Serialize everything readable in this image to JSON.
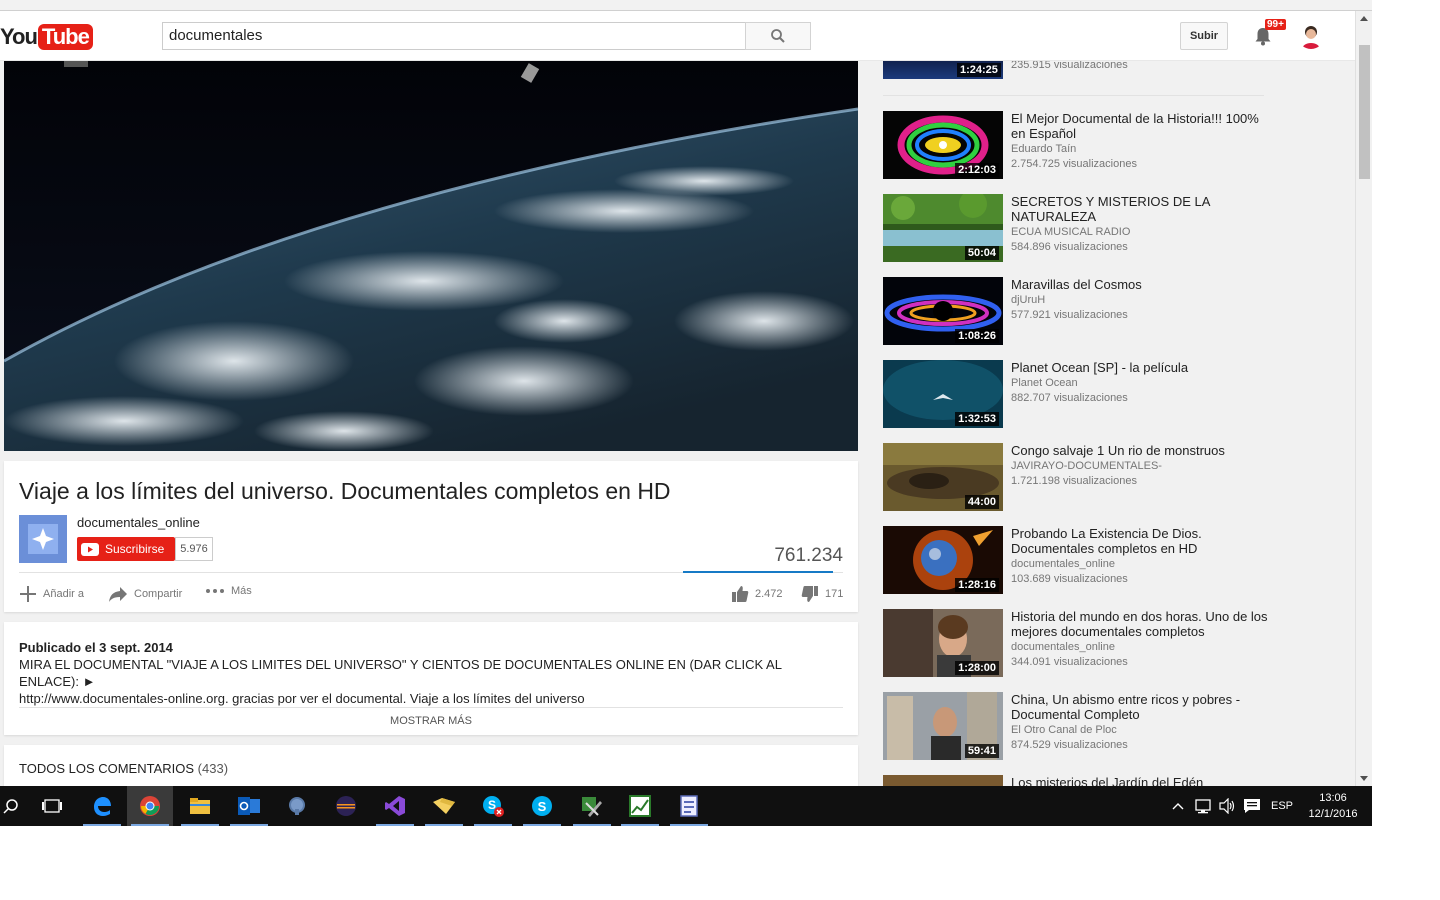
{
  "header": {
    "logo_you": "You",
    "logo_tube": "Tube",
    "search_value": "documentales",
    "upload_label": "Subir",
    "notification_count": "99+"
  },
  "video": {
    "title": "Viaje a los límites del universo. Documentales completos en HD",
    "channel": "documentales_online",
    "subscribe_label": "Suscribirse",
    "subscriber_count": "5.976",
    "views": "761.234",
    "like_ratio": 0.935,
    "actions": {
      "add": "Añadir a",
      "share": "Compartir",
      "more": "Más"
    },
    "likes": "2.472",
    "dislikes": "171"
  },
  "description": {
    "published": "Publicado el 3 sept. 2014",
    "line1": "MIRA EL DOCUMENTAL \"VIAJE A LOS LIMITES DEL UNIVERSO\" Y CIENTOS DE DOCUMENTALES ONLINE EN (DAR CLICK AL ENLACE): ►",
    "line2": "http://www.documentales-online.org. gracias por ver el documental. Viaje a los límites del universo",
    "show_more": "MOSTRAR MÁS"
  },
  "comments": {
    "label": "TODOS LOS COMENTARIOS",
    "count": "(433)"
  },
  "sidebar": {
    "top_item": {
      "duration": "1:24:25",
      "views": "235.915 visualizaciones"
    },
    "videos": [
      {
        "title": "El Mejor Documental de la Historia!!! 100% en Español",
        "channel": "Eduardo Taín",
        "views": "2.754.725 visualizaciones",
        "duration": "2:12:03"
      },
      {
        "title": "SECRETOS Y MISTERIOS DE LA NATURALEZA",
        "channel": "ECUA MUSICAL RADIO",
        "views": "584.896 visualizaciones",
        "duration": "50:04"
      },
      {
        "title": "Maravillas del Cosmos",
        "channel": "djUruH",
        "views": "577.921 visualizaciones",
        "duration": "1:08:26"
      },
      {
        "title": "Planet Ocean [SP] - la película",
        "channel": "Planet Ocean",
        "views": "882.707 visualizaciones",
        "duration": "1:32:53"
      },
      {
        "title": "Congo salvaje 1 Un rio de monstruos",
        "channel": "JAVIRAYO-DOCUMENTALES-",
        "views": "1.721.198 visualizaciones",
        "duration": "44:00"
      },
      {
        "title": "Probando La Existencia De Dios. Documentales completos en HD",
        "channel": "documentales_online",
        "views": "103.689 visualizaciones",
        "duration": "1:28:16"
      },
      {
        "title": "Historia del mundo en dos horas. Uno de los mejores documentales completos",
        "channel": "documentales_online",
        "views": "344.091 visualizaciones",
        "duration": "1:28:00"
      },
      {
        "title": "China, Un abismo entre ricos y pobres - Documental Completo",
        "channel": "El Otro Canal de Ploc",
        "views": "874.529 visualizaciones",
        "duration": "59:41"
      },
      {
        "title": "Los misterios del Jardín del Edén",
        "channel": "",
        "views": "",
        "duration": ""
      }
    ]
  },
  "taskbar": {
    "language": "ESP",
    "time": "13:06",
    "date": "12/1/2016"
  }
}
